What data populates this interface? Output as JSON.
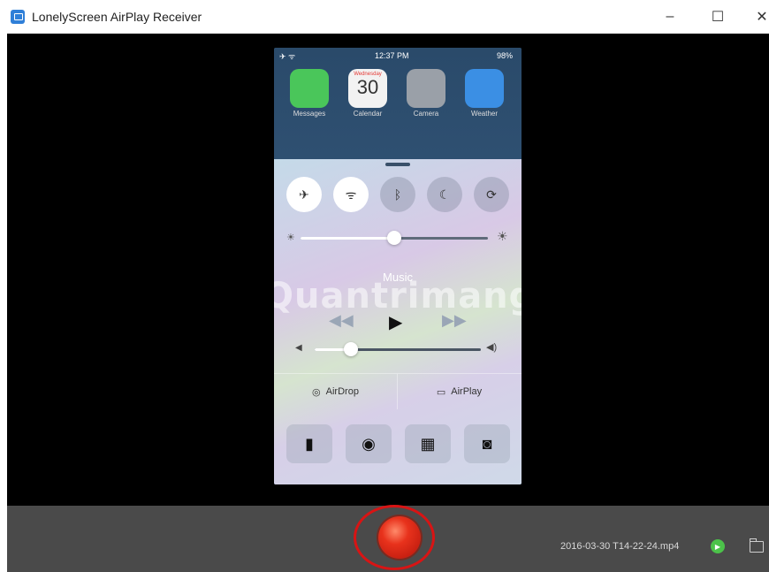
{
  "window": {
    "title": "LonelyScreen AirPlay Receiver",
    "minimize_glyph": "–",
    "maximize_glyph": "☐",
    "close_glyph": "✕"
  },
  "phone": {
    "status": {
      "time": "12:37 PM",
      "battery": "98%"
    },
    "apps": [
      {
        "label": "Messages",
        "color": "#4ac65a"
      },
      {
        "label": "Calendar",
        "color": "#f2f2f2"
      },
      {
        "label": "Camera",
        "color": "#9aa0a8"
      },
      {
        "label": "Weather",
        "color": "#3b8fe4"
      }
    ],
    "calendar_day": "Wednesday",
    "calendar_date": "30",
    "control_center": {
      "music_label": "Music",
      "airdrop_label": "AirDrop",
      "airplay_label": "AirPlay",
      "brightness_level": 0.5,
      "volume_level": 0.22
    }
  },
  "watermark": "Quantrimang",
  "footer": {
    "filename": "2016-03-30 T14-22-24.mp4"
  },
  "colors": {
    "record": "#e8321c",
    "ring": "#d81414",
    "play": "#4cc24a",
    "bar": "#4a4a4a"
  }
}
